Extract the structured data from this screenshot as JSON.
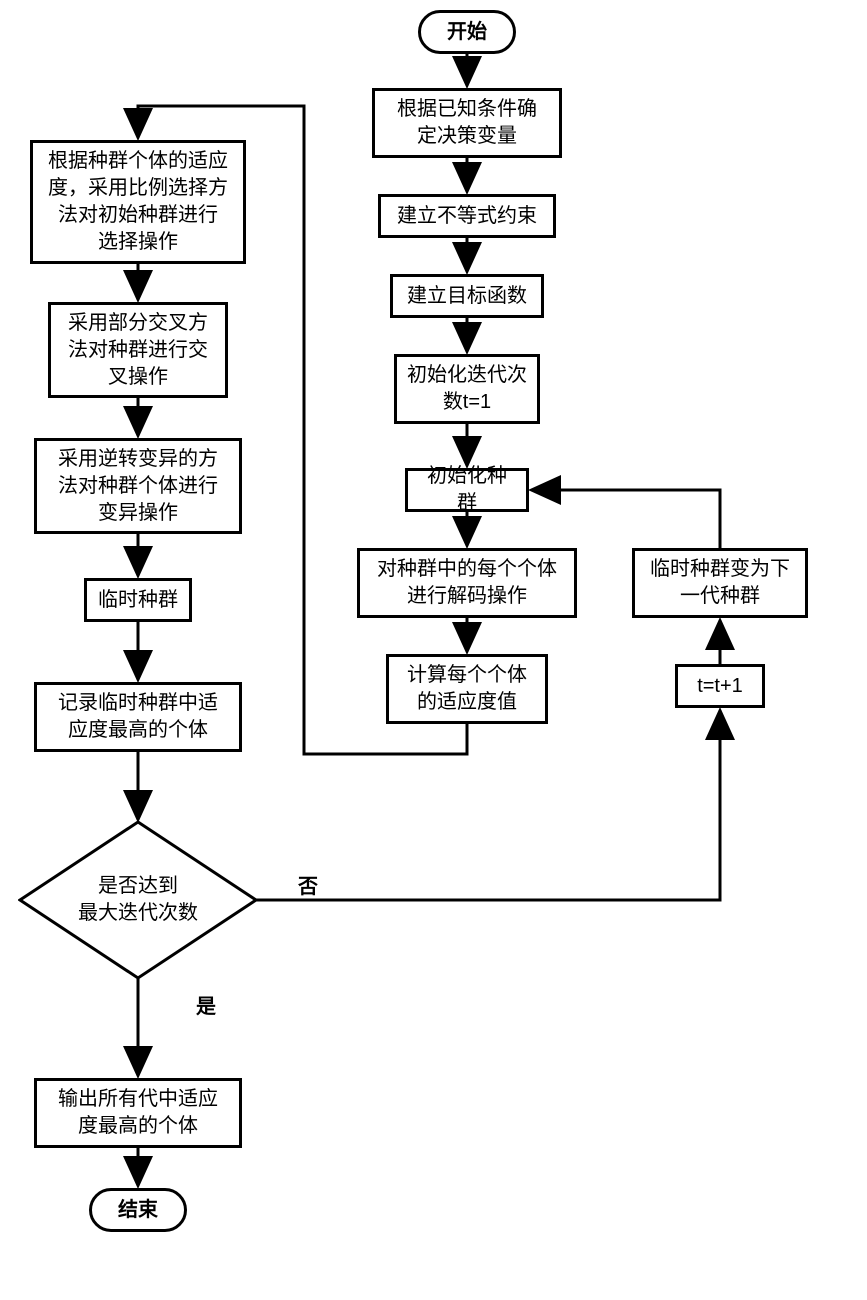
{
  "chart_data": {
    "type": "flowchart",
    "nodes": [
      {
        "id": "start",
        "kind": "terminal",
        "label": "开始"
      },
      {
        "id": "n1",
        "kind": "process",
        "label": "根据已知条件确\n定决策变量"
      },
      {
        "id": "n2",
        "kind": "process",
        "label": "建立不等式约束"
      },
      {
        "id": "n3",
        "kind": "process",
        "label": "建立目标函数"
      },
      {
        "id": "n4",
        "kind": "process",
        "label": "初始化迭代次\n数t=1"
      },
      {
        "id": "n5",
        "kind": "process",
        "label": "初始化种群"
      },
      {
        "id": "n6",
        "kind": "process",
        "label": "对种群中的每个个体\n进行解码操作"
      },
      {
        "id": "n7",
        "kind": "process",
        "label": "计算每个个体\n的适应度值"
      },
      {
        "id": "l1",
        "kind": "process",
        "label": "根据种群个体的适应\n度，采用比例选择方\n法对初始种群进行\n选择操作"
      },
      {
        "id": "l2",
        "kind": "process",
        "label": "采用部分交叉方\n法对种群进行交\n叉操作"
      },
      {
        "id": "l3",
        "kind": "process",
        "label": "采用逆转变异的方\n法对种群个体进行\n变异操作"
      },
      {
        "id": "l4",
        "kind": "process",
        "label": "临时种群"
      },
      {
        "id": "l5",
        "kind": "process",
        "label": "记录临时种群中适\n应度最高的个体"
      },
      {
        "id": "d1",
        "kind": "decision",
        "label": "是否达到\n最大迭代次数"
      },
      {
        "id": "l6",
        "kind": "process",
        "label": "输出所有代中适应\n度最高的个体"
      },
      {
        "id": "end",
        "kind": "terminal",
        "label": "结束"
      },
      {
        "id": "r1",
        "kind": "process",
        "label": "t=t+1"
      },
      {
        "id": "r2",
        "kind": "process",
        "label": "临时种群变为下\n一代种群"
      }
    ],
    "edges": [
      {
        "from": "start",
        "to": "n1"
      },
      {
        "from": "n1",
        "to": "n2"
      },
      {
        "from": "n2",
        "to": "n3"
      },
      {
        "from": "n3",
        "to": "n4"
      },
      {
        "from": "n4",
        "to": "n5"
      },
      {
        "from": "n5",
        "to": "n6"
      },
      {
        "from": "n6",
        "to": "n7"
      },
      {
        "from": "n7",
        "to": "l1"
      },
      {
        "from": "l1",
        "to": "l2"
      },
      {
        "from": "l2",
        "to": "l3"
      },
      {
        "from": "l3",
        "to": "l4"
      },
      {
        "from": "l4",
        "to": "l5"
      },
      {
        "from": "l5",
        "to": "d1"
      },
      {
        "from": "d1",
        "to": "l6",
        "label": "是"
      },
      {
        "from": "l6",
        "to": "end"
      },
      {
        "from": "d1",
        "to": "r1",
        "label": "否"
      },
      {
        "from": "r1",
        "to": "r2"
      },
      {
        "from": "r2",
        "to": "n5"
      }
    ]
  },
  "labels": {
    "start": "开始",
    "n1": "根据已知条件确\n定决策变量",
    "n2": "建立不等式约束",
    "n3": "建立目标函数",
    "n4": "初始化迭代次\n数t=1",
    "n5": "初始化种群",
    "n6": "对种群中的每个个体\n进行解码操作",
    "n7": "计算每个个体\n的适应度值",
    "l1": "根据种群个体的适应\n度，采用比例选择方\n法对初始种群进行\n选择操作",
    "l2": "采用部分交叉方\n法对种群进行交\n叉操作",
    "l3": "采用逆转变异的方\n法对种群个体进行\n变异操作",
    "l4": "临时种群",
    "l5": "记录临时种群中适\n应度最高的个体",
    "d1": "是否达到\n最大迭代次数",
    "l6": "输出所有代中适应\n度最高的个体",
    "end": "结束",
    "r1": "t=t+1",
    "r2": "临时种群变为下\n一代种群",
    "yes": "是",
    "no": "否"
  }
}
